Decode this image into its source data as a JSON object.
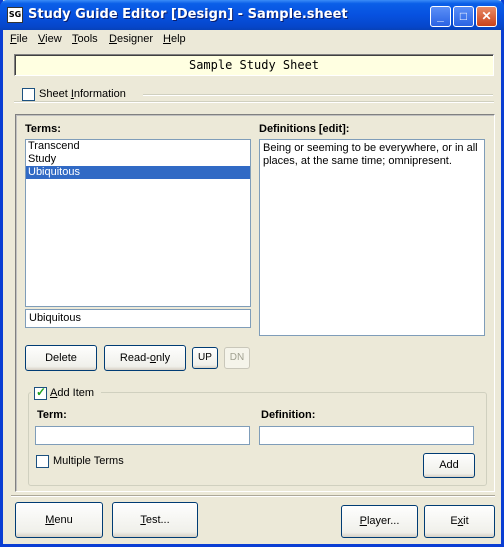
{
  "window": {
    "title": "Study Guide Editor [Design] - Sample.sheet",
    "icon_label": "SG",
    "minimize_glyph": "_",
    "maximize_glyph": "□",
    "close_glyph": "✕"
  },
  "menu": {
    "items": [
      {
        "mn": "F",
        "rest": "ile"
      },
      {
        "mn": "V",
        "rest": "iew"
      },
      {
        "mn": "T",
        "rest": "ools"
      },
      {
        "mn": "D",
        "rest": "esigner"
      },
      {
        "mn": "H",
        "rest": "elp"
      }
    ]
  },
  "sheet": {
    "title": "Sample Study Sheet",
    "info_label_pre": "Sheet ",
    "info_label_mn": "I",
    "info_label_post": "nformation",
    "info_checked": false
  },
  "terms": {
    "heading": "Terms:",
    "items": [
      "Transcend",
      "Study",
      "Ubiquitous"
    ],
    "selected_index": 2,
    "edit_value": "Ubiquitous"
  },
  "definitions": {
    "heading": "Definitions [edit]:",
    "text": "Being or seeming to be everywhere, or in all places, at the same time; omnipresent."
  },
  "buttons": {
    "delete": "Delete",
    "readonly_pre": "Read-",
    "readonly_mn": "o",
    "readonly_post": "nly",
    "up": "UP",
    "dn": "DN",
    "add": "Add",
    "menu_mn": "M",
    "menu_post": "enu",
    "test_mn": "T",
    "test_post": "est...",
    "player_mn": "P",
    "player_post": "layer...",
    "exit_pre": "E",
    "exit_mn": "x",
    "exit_post": "it"
  },
  "add_item": {
    "label_mn": "A",
    "label_post": "dd Item",
    "checked": true,
    "term_label": "Term:",
    "term_value": "",
    "definition_label": "Definition:",
    "definition_value": "",
    "multiple_terms_label": "Multiple Terms",
    "multiple_checked": false
  }
}
